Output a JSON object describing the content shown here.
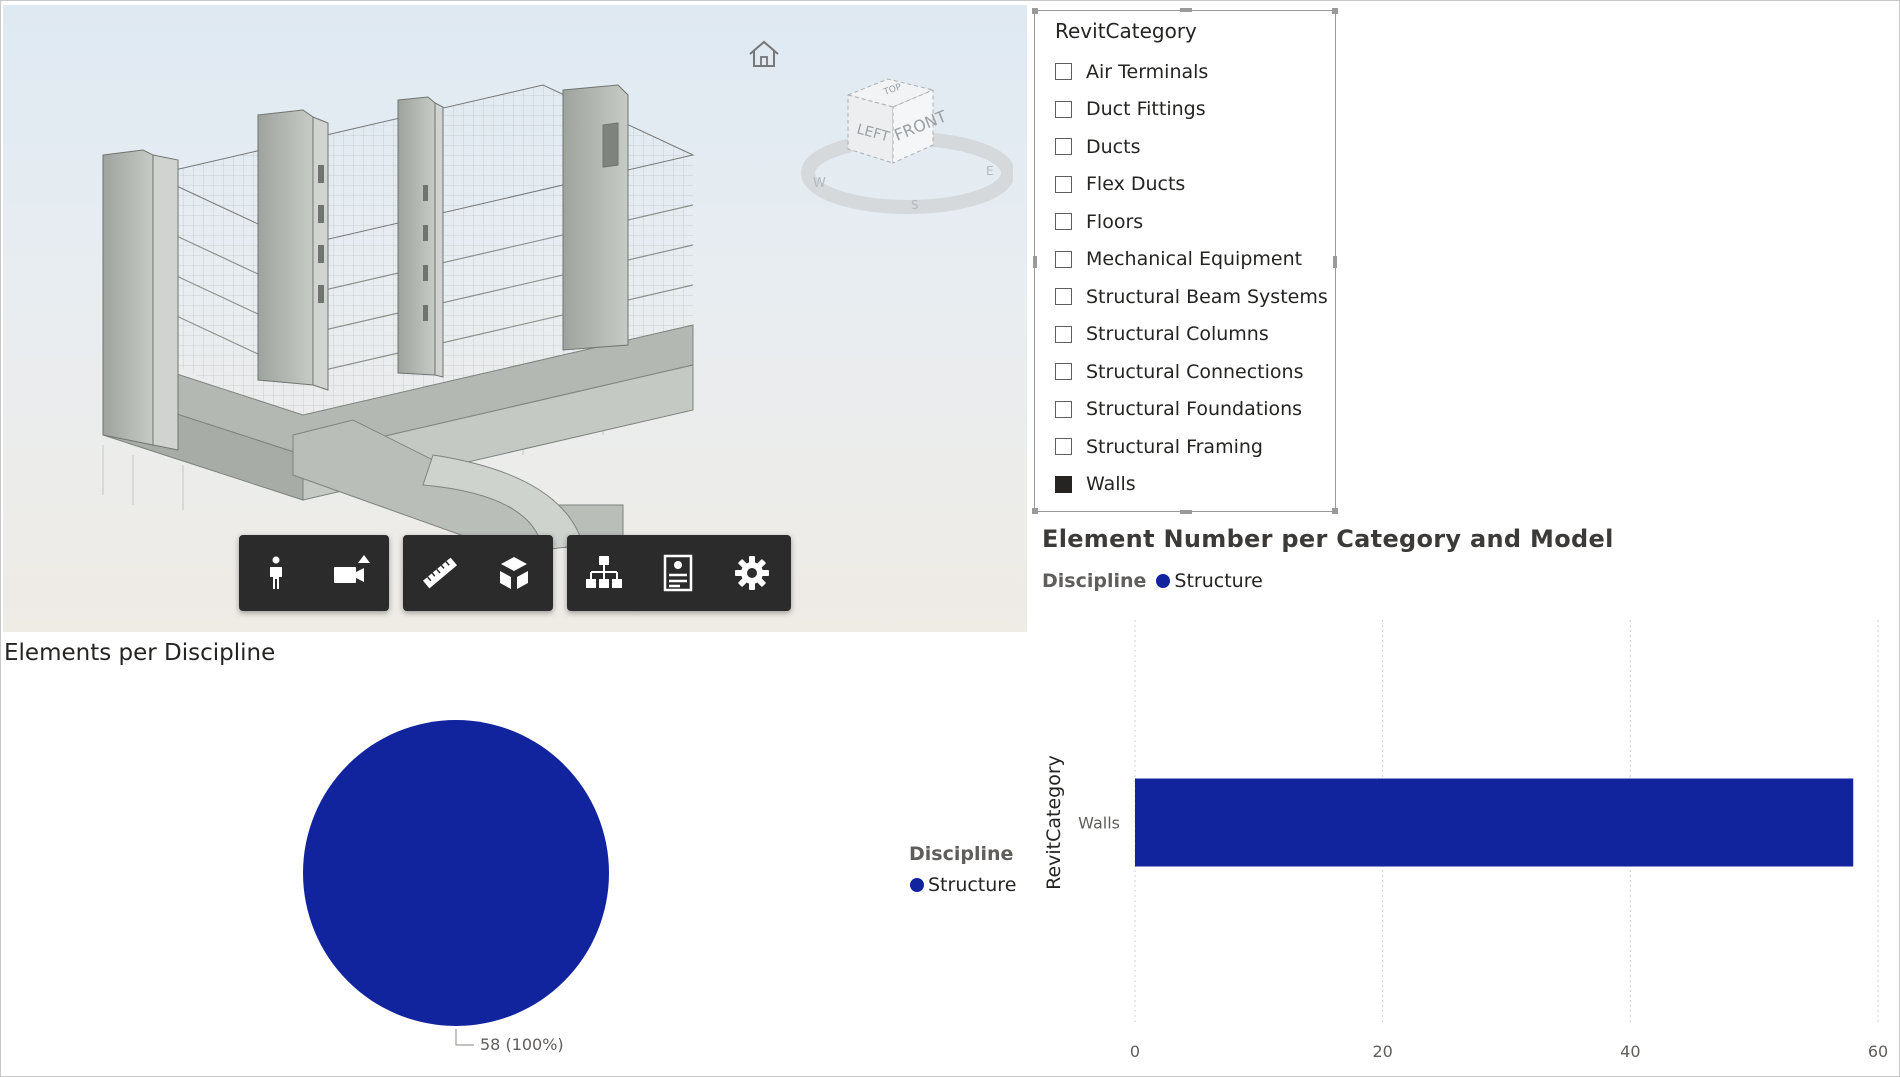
{
  "slicer": {
    "title": "RevitCategory",
    "items": [
      {
        "label": "Air Terminals",
        "checked": false
      },
      {
        "label": "Duct Fittings",
        "checked": false
      },
      {
        "label": "Ducts",
        "checked": false
      },
      {
        "label": "Flex Ducts",
        "checked": false
      },
      {
        "label": "Floors",
        "checked": false
      },
      {
        "label": "Mechanical Equipment",
        "checked": false
      },
      {
        "label": "Structural Beam Systems",
        "checked": false
      },
      {
        "label": "Structural Columns",
        "checked": false
      },
      {
        "label": "Structural Connections",
        "checked": false
      },
      {
        "label": "Structural Foundations",
        "checked": false
      },
      {
        "label": "Structural Framing",
        "checked": false
      },
      {
        "label": "Walls",
        "checked": true
      }
    ]
  },
  "viewer": {
    "viewcube": {
      "top": "TOP",
      "left": "LEFT",
      "front": "FRONT",
      "compass": [
        "W",
        "S",
        "E"
      ]
    },
    "toolbar_icons": [
      "walk-icon",
      "camera-icon",
      "measure-icon",
      "section-box-icon",
      "model-tree-icon",
      "properties-icon",
      "settings-icon"
    ]
  },
  "pie_visual": {
    "title": "Elements per Discipline",
    "legend_title": "Discipline",
    "legend_item": "Structure",
    "slice_label": "58 (100%)"
  },
  "bar_visual": {
    "title": "Element Number per Category and Model",
    "legend_title": "Discipline",
    "legend_item": "Structure",
    "y_axis_label": "RevitCategory"
  },
  "colors": {
    "series": "#12239e",
    "toolbar": "#2b2b2b"
  },
  "chart_data": [
    {
      "type": "pie",
      "title": "Elements per Discipline",
      "categories": [
        "Structure"
      ],
      "values": [
        58
      ],
      "data_labels": [
        "58 (100%)"
      ],
      "legend": {
        "title": "Discipline",
        "entries": [
          "Structure"
        ],
        "placement": "right"
      }
    },
    {
      "type": "bar",
      "orientation": "horizontal",
      "title": "Element Number per Category and Model",
      "categories": [
        "Walls"
      ],
      "series": [
        {
          "name": "Structure",
          "values": [
            58
          ]
        }
      ],
      "ylabel": "RevitCategory",
      "xlabel": "",
      "xlim": [
        0,
        60
      ],
      "xticks": [
        0,
        20,
        40,
        60
      ],
      "grid": true,
      "legend": {
        "title": "Discipline",
        "entries": [
          "Structure"
        ],
        "placement": "top-left"
      }
    }
  ]
}
